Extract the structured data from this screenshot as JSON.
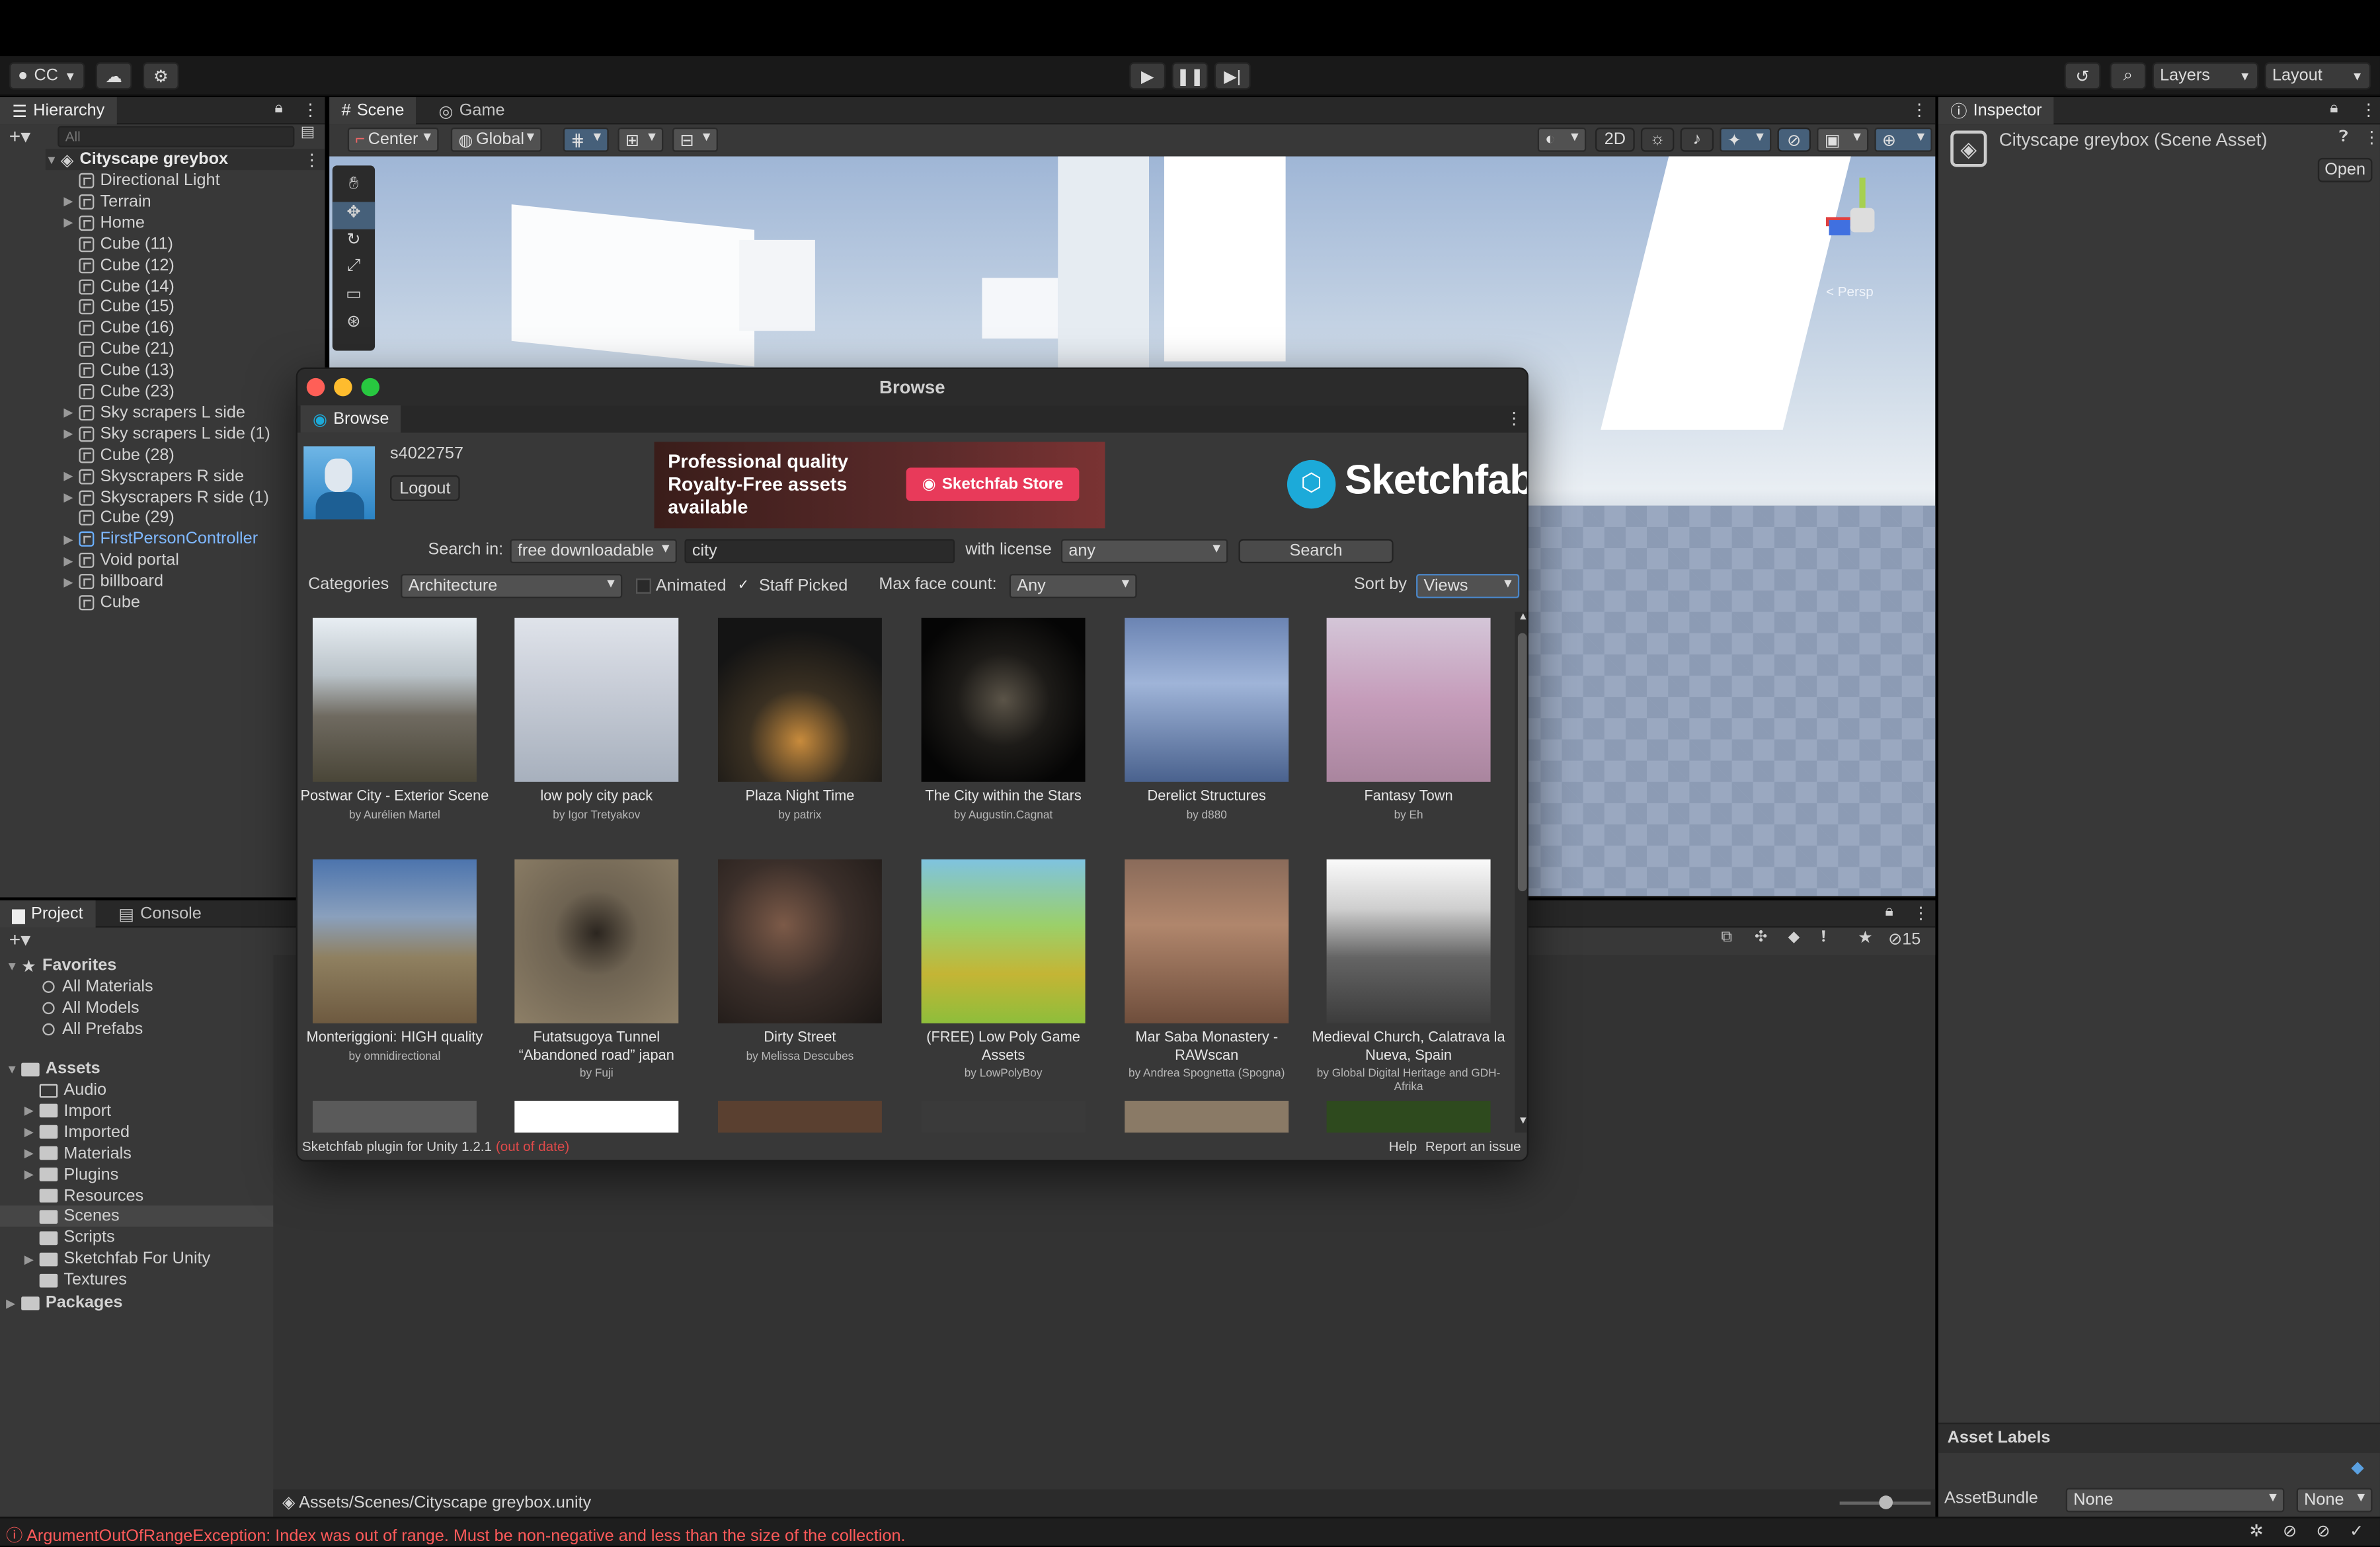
{
  "colors": {
    "accent": "#2c5d87",
    "error": "#ff5a5a",
    "sketchfab": "#1caad9",
    "store_red": "#e83a5a"
  },
  "toolbar": {
    "account": "CC",
    "layers": "Layers",
    "layout": "Layout"
  },
  "hierarchy": {
    "tab": "Hierarchy",
    "search_placeholder": "All",
    "root": "Cityscape greybox",
    "items": [
      {
        "label": "Directional Light",
        "fold": false
      },
      {
        "label": "Terrain",
        "fold": true
      },
      {
        "label": "Home",
        "fold": true
      },
      {
        "label": "Cube (11)",
        "fold": false
      },
      {
        "label": "Cube (12)",
        "fold": false
      },
      {
        "label": "Cube (14)",
        "fold": false
      },
      {
        "label": "Cube (15)",
        "fold": false
      },
      {
        "label": "Cube (16)",
        "fold": false
      },
      {
        "label": "Cube (21)",
        "fold": false
      },
      {
        "label": "Cube (13)",
        "fold": false
      },
      {
        "label": "Cube (23)",
        "fold": false
      },
      {
        "label": "Sky scrapers L side",
        "fold": true
      },
      {
        "label": "Sky scrapers L side (1)",
        "fold": true
      },
      {
        "label": "Cube (28)",
        "fold": false
      },
      {
        "label": "Skyscrapers R side",
        "fold": true
      },
      {
        "label": "Skyscrapers R side (1)",
        "fold": true
      },
      {
        "label": "Cube (29)",
        "fold": false
      },
      {
        "label": "FirstPersonController",
        "fold": true
      },
      {
        "label": "Void portal",
        "fold": true
      },
      {
        "label": "billboard",
        "fold": true
      },
      {
        "label": "Cube",
        "fold": false
      }
    ]
  },
  "scene": {
    "tab_scene": "Scene",
    "tab_game": "Game",
    "pivot": "Center",
    "space": "Global",
    "mode_2d": "2D",
    "persp": "< Persp"
  },
  "inspector": {
    "tab": "Inspector",
    "title": "Cityscape greybox (Scene Asset)",
    "open": "Open",
    "asset_labels": "Asset Labels",
    "assetbundle": "AssetBundle",
    "bundle_value": "None",
    "variant_value": "None"
  },
  "project": {
    "tab_project": "Project",
    "tab_console": "Console",
    "hidden_count": "15",
    "favorites": "Favorites",
    "fav_items": [
      "All Materials",
      "All Models",
      "All Prefabs"
    ],
    "assets": "Assets",
    "asset_items": [
      {
        "label": "Audio",
        "fold": false
      },
      {
        "label": "Import",
        "fold": true
      },
      {
        "label": "Imported",
        "fold": true
      },
      {
        "label": "Materials",
        "fold": true
      },
      {
        "label": "Plugins",
        "fold": true
      },
      {
        "label": "Resources",
        "fold": false
      },
      {
        "label": "Scenes",
        "fold": false
      },
      {
        "label": "Scripts",
        "fold": false
      },
      {
        "label": "Sketchfab For Unity",
        "fold": true
      },
      {
        "label": "Textures",
        "fold": false
      }
    ],
    "packages": "Packages",
    "path": "Assets/Scenes/Cityscape greybox.unity"
  },
  "browse": {
    "window_title": "Browse",
    "tab": "Browse",
    "username": "s4022757",
    "logout": "Logout",
    "banner_line1": "Professional quality",
    "banner_line2": "Royalty-Free assets",
    "banner_line3": "available",
    "store_button": "Sketchfab Store",
    "brand": "Sketchfab",
    "search_in_label": "Search in:",
    "search_in": "free downloadable",
    "query": "city",
    "license_label": "with license",
    "license": "any",
    "search_button": "Search",
    "categories_label": "Categories",
    "category": "Architecture",
    "animated": "Animated",
    "staff_picked": "Staff Picked",
    "max_face_label": "Max face count:",
    "max_face": "Any",
    "sort_label": "Sort by",
    "sort": "Views",
    "footer_version": "Sketchfab plugin for Unity 1.2.1",
    "footer_outdated": "(out of date)",
    "help": "Help",
    "report": "Report an issue",
    "models": [
      {
        "title": "Postwar City - Exterior Scene",
        "author": "by Aurélien Martel"
      },
      {
        "title": "low poly city pack",
        "author": "by Igor Tretyakov"
      },
      {
        "title": "Plaza Night Time",
        "author": "by patrix"
      },
      {
        "title": "The City within the Stars",
        "author": "by Augustin.Cagnat"
      },
      {
        "title": "Derelict Structures",
        "author": "by d880"
      },
      {
        "title": "Fantasy Town",
        "author": "by Eh"
      },
      {
        "title": "Monteriggioni: HIGH quality",
        "author": "by omnidirectional"
      },
      {
        "title": "Futatsugoya Tunnel “Abandoned road” japan",
        "author": "by Fuji"
      },
      {
        "title": "Dirty Street",
        "author": "by Melissa Descubes"
      },
      {
        "title": "(FREE) Low Poly Game Assets",
        "author": "by LowPolyBoy"
      },
      {
        "title": "Mar Saba Monastery -RAWscan",
        "author": "by Andrea Spognetta (Spogna)"
      },
      {
        "title": "Medieval Church, Calatrava la Nueva, Spain",
        "author": "by Global Digital Heritage and GDH-Afrika"
      }
    ]
  },
  "status": {
    "error": "ArgumentOutOfRangeException: Index was out of range. Must be non-negative and less than the size of the collection."
  }
}
